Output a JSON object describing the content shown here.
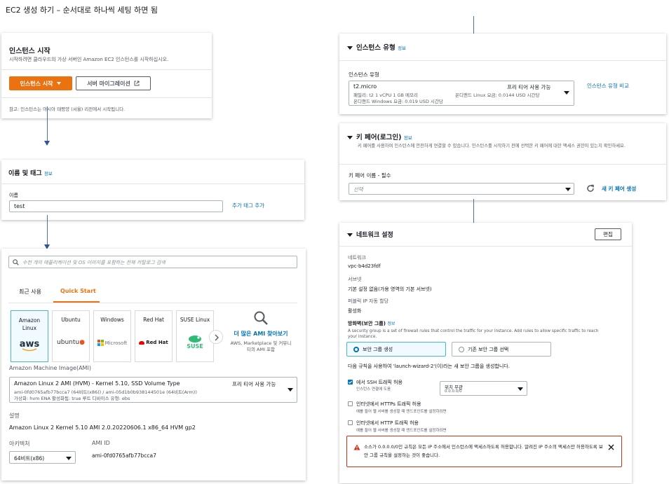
{
  "page_title": "EC2 생성 하기 – 순서대로 하나씩 세팅 하면 됨",
  "launch": {
    "title": "인스턴스 시작",
    "desc": "시작하려면 클라우드의 가상 서버인 Amazon EC2 인스턴스를 시작하십시오.",
    "launch_button": "인스턴스 시작",
    "migrate_button": "서버 마이그레이션",
    "note": "참고: 인스턴스는 아시아 태평양 (서울) 리전에서 시작됩니다."
  },
  "name_tags": {
    "title": "이름 및 태그",
    "info": "정보",
    "name_label": "이름",
    "name_value": "test",
    "add_tags": "추가 태그 추가"
  },
  "ami": {
    "search_placeholder": "수천 개의 애플리케이션 및 OS 이미지를 포함하는 전체 카탈로그 검색",
    "tabs": [
      "최근 사용",
      "Quick Start"
    ],
    "tiles": [
      {
        "name": "Amazon Linux",
        "logo": "aws"
      },
      {
        "name": "Ubuntu",
        "logo": "ubuntu"
      },
      {
        "name": "Windows",
        "logo": "Microsoft"
      },
      {
        "name": "Red Hat",
        "logo": "Red Hat"
      },
      {
        "name": "SUSE Linux",
        "logo": "SUSE"
      }
    ],
    "more_title": "더 많은 AMI 찾아보기",
    "more_desc": "AWS, Marketplace 및 커뮤니티의 AMI 포함",
    "ami_label": "Amazon Machine Image(AMI)",
    "ami_name": "Amazon Linux 2 AMI (HVM) - Kernel 5.10, SSD Volume Type",
    "ami_free": "프리 티어 사용 가능",
    "ami_ids": "ami-0fd0765afb77bcca7 (64비트(x86)) / ami-05d1b0b938144501e (64비트(Arm))",
    "ami_attrs": "가상화: hvm     ENA 활성화됨: true     루트 디바이스 유형: ebs",
    "desc_label": "설명",
    "desc_value": "Amazon Linux 2 Kernel 5.10 AMI 2.0.20220606.1 x86_64 HVM gp2",
    "arch_label": "아키텍처",
    "arch_value": "64비트(x86)",
    "ami_id_label": "AMI ID",
    "ami_id_value": "ami-0fd0765afb77bcca7"
  },
  "instance_type": {
    "title": "인스턴스 유형",
    "info": "정보",
    "label": "인스턴스 유형",
    "type": "t2.micro",
    "free": "프리 티어 사용 가능",
    "spec": "패밀리: t2     1 vCPU     1 GB 메모리",
    "linux_price": "온디맨드 Linux 요금: 0.0144 USD 시간당",
    "windows_price": "온디맨드 Windows 요금: 0.019 USD 시간당",
    "compare": "인스턴스 유형 비교"
  },
  "key_pair": {
    "title": "키 페어(로그인)",
    "info": "정보",
    "desc": "키 페어를 사용하여 인스턴스에 안전하게 연결할 수 있습니다. 인스턴스를 시작하기 전에 선택한 키 페어에 대한 액세스 권한이 있는지 확인하세요.",
    "label": "키 페어 이름 - 필수",
    "placeholder": "선택",
    "new": "새 키 페어 생성"
  },
  "network": {
    "title": "네트워크 설정",
    "edit": "편집",
    "network_label": "네트워크",
    "network_value": "vpc-b4d23fdf",
    "subnet_label": "서브넷",
    "subnet_value": "기본 설정 없음(가용 영역의 기본 서브넷)",
    "public_ip_label": "퍼블릭 IP 자동 할당",
    "public_ip_value": "활성화",
    "firewall_label": "방화벽(보안 그룹)",
    "firewall_info": "정보",
    "firewall_desc": "A security group is a set of firewall rules that control the traffic for your instance. Add rules to allow specific traffic to reach your instance.",
    "create_sg": "보안 그룹 생성",
    "existing_sg": "기존 보안 그룹 선택",
    "rule_text": "다음 규칙을 사용하여 'launch-wizard-2'(이)라는 새 보안 그룹을 생성합니다.",
    "ssh_label": "에서 SSH 트래픽 허용",
    "ssh_sub": "인스턴스 연결에 도움",
    "anywhere": "위치 무관",
    "anywhere_sub": "0.0.0.0/0",
    "https_label": "인터넷에서 HTTPs 트래픽 허용",
    "https_sub": "예를 들어 웹 서버를 생성할 때 엔드포인트를 설정하려면",
    "http_label": "인터넷에서 HTTP 트래픽 허용",
    "http_sub": "예를 들어 웹 서버를 생성할 때 엔드포인트를 설정하려면",
    "warning": "소스가 0.0.0.0/0인 규칙은 모든 IP 주소에서 인스턴스에 액세스하도록 허용합니다. 알려진 IP 주소의 액세스만 허용하도록 보안 그룹 규칙을 설정하는 것이 좋습니다."
  },
  "colors": {
    "accent": "#ec7211",
    "link": "#0073bb",
    "arrow": "#2f5597",
    "warning": "#d13212"
  },
  "icons": [
    "external-link-icon",
    "search-icon",
    "refresh-icon",
    "warning-icon",
    "close-icon",
    "chevron-right-icon"
  ]
}
